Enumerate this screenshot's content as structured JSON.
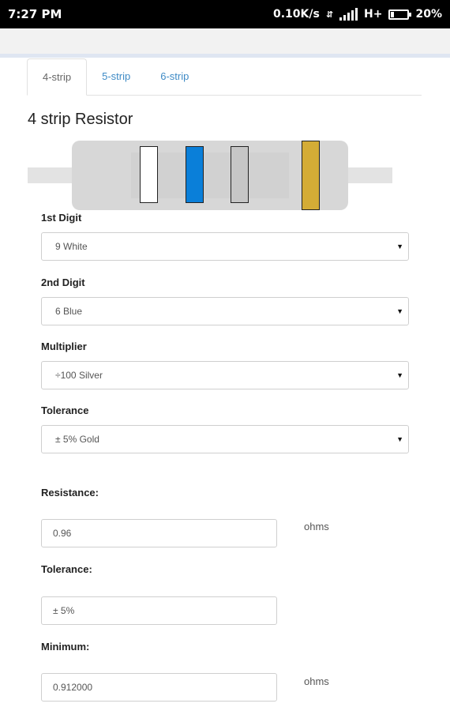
{
  "status": {
    "time": "7:27 PM",
    "speed": "0.10K/s",
    "network": "H+",
    "battery": "20%",
    "battery_level": 0.2
  },
  "tabs": [
    {
      "label": "4-strip",
      "active": true
    },
    {
      "label": "5-strip",
      "active": false
    },
    {
      "label": "6-strip",
      "active": false
    }
  ],
  "title": "4 strip Resistor",
  "bands": [
    {
      "name": "digit1",
      "color": "#ffffff"
    },
    {
      "name": "digit2",
      "color": "#0a7fd9"
    },
    {
      "name": "multiplier",
      "color": "#c6c6c6"
    },
    {
      "name": "tolerance",
      "color": "#d4ac36"
    }
  ],
  "selects": [
    {
      "label": "1st Digit",
      "value": "9 White"
    },
    {
      "label": "2nd Digit",
      "value": "6 Blue"
    },
    {
      "label": "Multiplier",
      "value": "÷100 Silver"
    },
    {
      "label": "Tolerance",
      "value": "± 5% Gold"
    }
  ],
  "results": [
    {
      "label": "Resistance:",
      "value": "0.96",
      "unit": "ohms"
    },
    {
      "label": "Tolerance:",
      "value": "± 5%",
      "unit": ""
    },
    {
      "label": "Minimum:",
      "value": "0.912000",
      "unit": "ohms"
    }
  ]
}
